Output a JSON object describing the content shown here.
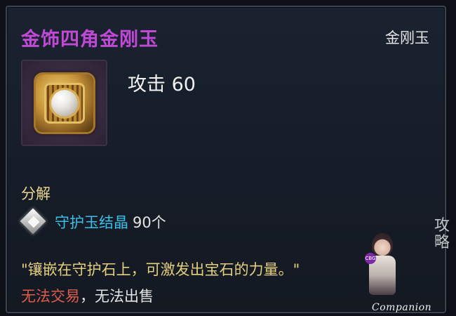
{
  "item": {
    "name": "金饰四角金刚玉",
    "category": "金刚玉",
    "icon": "gold-jewel-pearl-icon",
    "stat": "攻击 60",
    "name_color": "#c04ad6"
  },
  "disassemble": {
    "label": "分解",
    "material": {
      "icon": "guardian-crystal-icon",
      "name": "守护玉结晶",
      "count": "90个"
    }
  },
  "description": "\"镶嵌在守护石上，可激发出宝石的力量。\"",
  "trade": {
    "restriction": "无法交易",
    "separator": "，",
    "sell": "无法出售",
    "restriction_color": "#e05a4e"
  },
  "watermark": {
    "text": "Companion",
    "glyphs": "攻略",
    "badge": "CBG"
  }
}
